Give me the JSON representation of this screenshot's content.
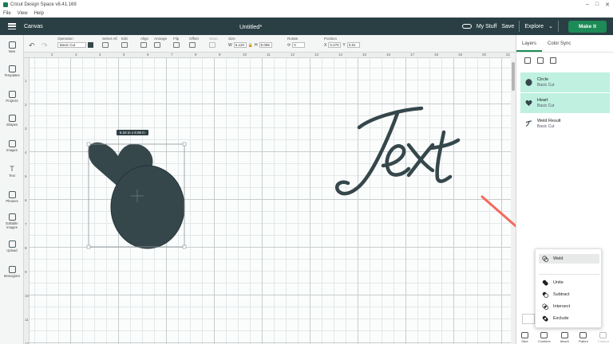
{
  "window": {
    "title": "Cricut Design Space v8.41.169",
    "menu": [
      "File",
      "View",
      "Help"
    ]
  },
  "header": {
    "canvas_label": "Canvas",
    "project_title": "Untitled*",
    "my_stuff": "My Stuff",
    "save": "Save",
    "explore": "Explore",
    "make_it": "Make It"
  },
  "toolbar": {
    "operation": {
      "label": "Operation",
      "value": "Basic Cut"
    },
    "select_all": "Select All",
    "edit": "Edit",
    "align": "Align",
    "arrange": "Arrange",
    "flip": "Flip",
    "offset": "Offset",
    "warp": "Warp",
    "size": {
      "label": "Size",
      "w_prefix": "W",
      "w": "6.120",
      "h_prefix": "H",
      "h": "5.096"
    },
    "rotate": {
      "label": "Rotate",
      "value": "0"
    },
    "position": {
      "label": "Position",
      "x_prefix": "X",
      "x": "0.270",
      "y_prefix": "Y",
      "y": "0.81"
    }
  },
  "sidebar": {
    "items": [
      {
        "label": "New",
        "icon": "plus-icon"
      },
      {
        "label": "Templates",
        "icon": "shirt-icon"
      },
      {
        "label": "Projects",
        "icon": "projects-icon"
      },
      {
        "label": "Shapes",
        "icon": "shapes-icon"
      },
      {
        "label": "Images",
        "icon": "lightbulb-icon"
      },
      {
        "label": "Text",
        "icon": "text-icon"
      },
      {
        "label": "Phrases",
        "icon": "phrases-icon"
      },
      {
        "label": "Editable Images",
        "icon": "editable-images-icon"
      },
      {
        "label": "Upload",
        "icon": "upload-icon"
      },
      {
        "label": "Monogram",
        "icon": "monogram-icon"
      }
    ]
  },
  "ruler": {
    "top": [
      "2",
      "3",
      "4",
      "5",
      "6",
      "7",
      "8",
      "9",
      "10",
      "11",
      "12",
      "13",
      "14",
      "15",
      "16",
      "17",
      "18",
      "19",
      "20",
      "21",
      "22",
      "23"
    ],
    "left": [
      "1",
      "2",
      "3",
      "4",
      "5",
      "6",
      "7",
      "8",
      "9",
      "10",
      "11",
      "12"
    ]
  },
  "canvas": {
    "selection_size": "6.34 in x 8.06 in",
    "text_art": "Text",
    "shape_color": "#35474b"
  },
  "panel": {
    "tabs": [
      "Layers",
      "Color Sync"
    ],
    "layers": [
      {
        "name": "Circle",
        "sub": "Basic Cut",
        "selected": true
      },
      {
        "name": "Heart",
        "sub": "Basic Cut",
        "selected": true
      },
      {
        "name": "Weld Result",
        "sub": "Basic Cut",
        "selected": false
      }
    ],
    "bottom_actions": [
      "Slice",
      "Combine",
      "Attach",
      "Flatten",
      "Contour"
    ]
  },
  "combine_menu": {
    "items": [
      "Weld",
      "Unite",
      "Subtract",
      "Intersect",
      "Exclude"
    ]
  },
  "colors": {
    "header_bg": "#2a3f44",
    "accent_green": "#1c8b56",
    "selected_layer": "#bff0e0",
    "arrow": "#f26a5c"
  }
}
